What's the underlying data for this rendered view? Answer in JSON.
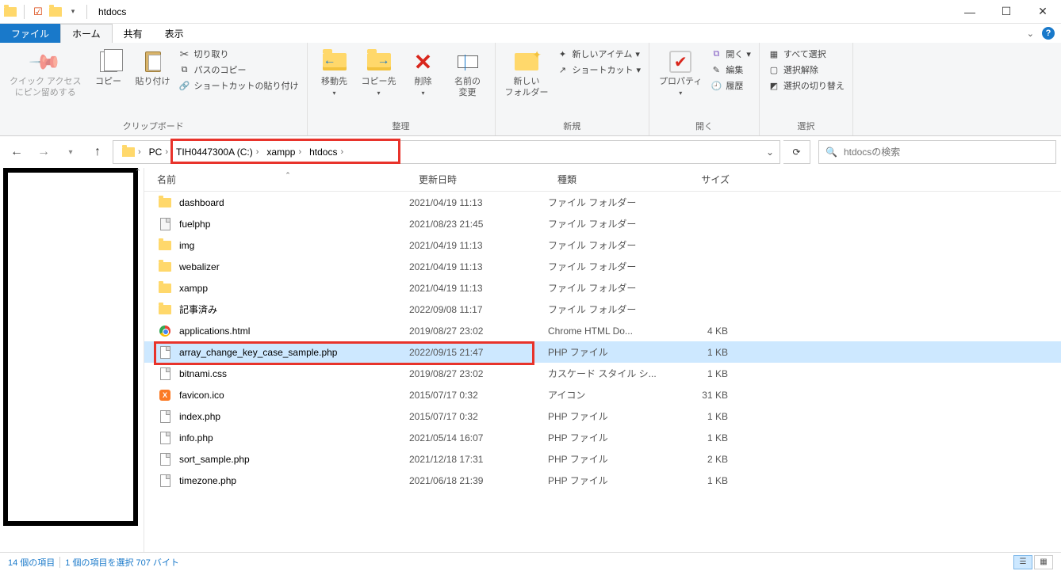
{
  "window": {
    "title": "htdocs"
  },
  "tabs": {
    "file": "ファイル",
    "home": "ホーム",
    "share": "共有",
    "view": "表示"
  },
  "ribbon": {
    "clipboard": {
      "label": "クリップボード",
      "pin": "クイック アクセス\nにピン留めする",
      "copy": "コピー",
      "paste": "貼り付け",
      "cut": "切り取り",
      "copypath": "パスのコピー",
      "pasteshortcut": "ショートカットの貼り付け"
    },
    "organize": {
      "label": "整理",
      "moveto": "移動先",
      "copyto": "コピー先",
      "delete": "削除",
      "rename": "名前の\n変更"
    },
    "new": {
      "label": "新規",
      "newfolder": "新しい\nフォルダー",
      "newitem": "新しいアイテム",
      "shortcut": "ショートカット"
    },
    "open": {
      "label": "開く",
      "properties": "プロパティ",
      "open": "開く",
      "edit": "編集",
      "history": "履歴"
    },
    "select": {
      "label": "選択",
      "selectall": "すべて選択",
      "selectnone": "選択解除",
      "invert": "選択の切り替え"
    }
  },
  "breadcrumb": {
    "pc": "PC",
    "drive": "TIH0447300A (C:)",
    "xampp": "xampp",
    "htdocs": "htdocs"
  },
  "search": {
    "placeholder": "htdocsの検索"
  },
  "columns": {
    "name": "名前",
    "date": "更新日時",
    "type": "種類",
    "size": "サイズ"
  },
  "files": [
    {
      "icon": "folder",
      "name": "dashboard",
      "date": "2021/04/19 11:13",
      "type": "ファイル フォルダー",
      "size": ""
    },
    {
      "icon": "fuel",
      "name": "fuelphp",
      "date": "2021/08/23 21:45",
      "type": "ファイル フォルダー",
      "size": ""
    },
    {
      "icon": "folder",
      "name": "img",
      "date": "2021/04/19 11:13",
      "type": "ファイル フォルダー",
      "size": ""
    },
    {
      "icon": "folder",
      "name": "webalizer",
      "date": "2021/04/19 11:13",
      "type": "ファイル フォルダー",
      "size": ""
    },
    {
      "icon": "folder",
      "name": "xampp",
      "date": "2021/04/19 11:13",
      "type": "ファイル フォルダー",
      "size": ""
    },
    {
      "icon": "folder",
      "name": "記事済み",
      "date": "2022/09/08 11:17",
      "type": "ファイル フォルダー",
      "size": ""
    },
    {
      "icon": "chrome",
      "name": "applications.html",
      "date": "2019/08/27 23:02",
      "type": "Chrome HTML Do...",
      "size": "4 KB"
    },
    {
      "icon": "file",
      "name": "array_change_key_case_sample.php",
      "date": "2022/09/15 21:47",
      "type": "PHP ファイル",
      "size": "1 KB",
      "selected": true
    },
    {
      "icon": "css",
      "name": "bitnami.css",
      "date": "2019/08/27 23:02",
      "type": "カスケード スタイル シ...",
      "size": "1 KB"
    },
    {
      "icon": "xampp",
      "name": "favicon.ico",
      "date": "2015/07/17 0:32",
      "type": "アイコン",
      "size": "31 KB"
    },
    {
      "icon": "file",
      "name": "index.php",
      "date": "2015/07/17 0:32",
      "type": "PHP ファイル",
      "size": "1 KB"
    },
    {
      "icon": "file",
      "name": "info.php",
      "date": "2021/05/14 16:07",
      "type": "PHP ファイル",
      "size": "1 KB"
    },
    {
      "icon": "file",
      "name": "sort_sample.php",
      "date": "2021/12/18 17:31",
      "type": "PHP ファイル",
      "size": "2 KB"
    },
    {
      "icon": "file",
      "name": "timezone.php",
      "date": "2021/06/18 21:39",
      "type": "PHP ファイル",
      "size": "1 KB"
    }
  ],
  "status": {
    "count": "14 個の項目",
    "selection": "1 個の項目を選択 707 バイト"
  }
}
